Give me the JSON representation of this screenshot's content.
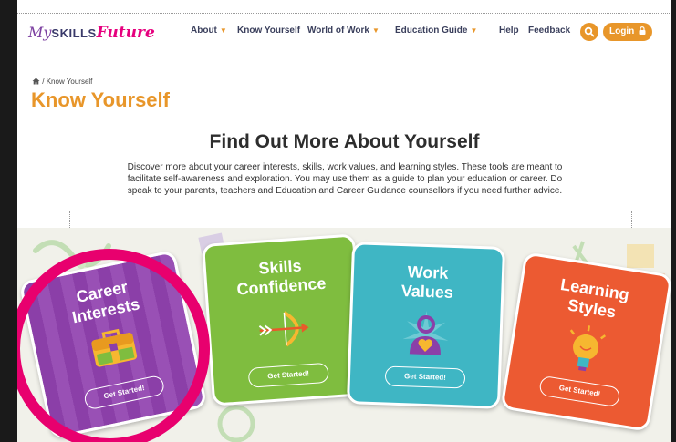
{
  "logo": {
    "my": "My",
    "skills": "SKILLS",
    "future": "Future"
  },
  "nav": {
    "about": "About",
    "know_yourself": "Know Yourself",
    "world_of_work": "World of Work",
    "education_guide": "Education Guide",
    "help": "Help",
    "feedback": "Feedback",
    "login": "Login"
  },
  "breadcrumb": {
    "separator": "/",
    "current": "Know Yourself"
  },
  "page_title": "Know Yourself",
  "main_heading": "Find Out More About Yourself",
  "intro": "Discover more about your career interests, skills, work values, and learning styles. These tools are meant to facilitate self-awareness and exploration. You may use them as a guide to plan your education or career. Do speak to your parents, teachers and Education and Career Guidance counsellors if you need further advice.",
  "cards": [
    {
      "title": "Career Interests",
      "cta": "Get Started!",
      "color": "#8b3fa8"
    },
    {
      "title": "Skills Confidence",
      "cta": "Get Started!",
      "color": "#7fbd3f"
    },
    {
      "title": "Work Values",
      "cta": "Get Started!",
      "color": "#3fb6c4"
    },
    {
      "title": "Learning Styles",
      "cta": "Get Started!",
      "color": "#ec5a32"
    }
  ],
  "colors": {
    "accent": "#e8962a",
    "highlight": "#e8006e"
  },
  "icons": {
    "home": "home-icon",
    "search": "search-icon",
    "lock": "lock-icon"
  }
}
